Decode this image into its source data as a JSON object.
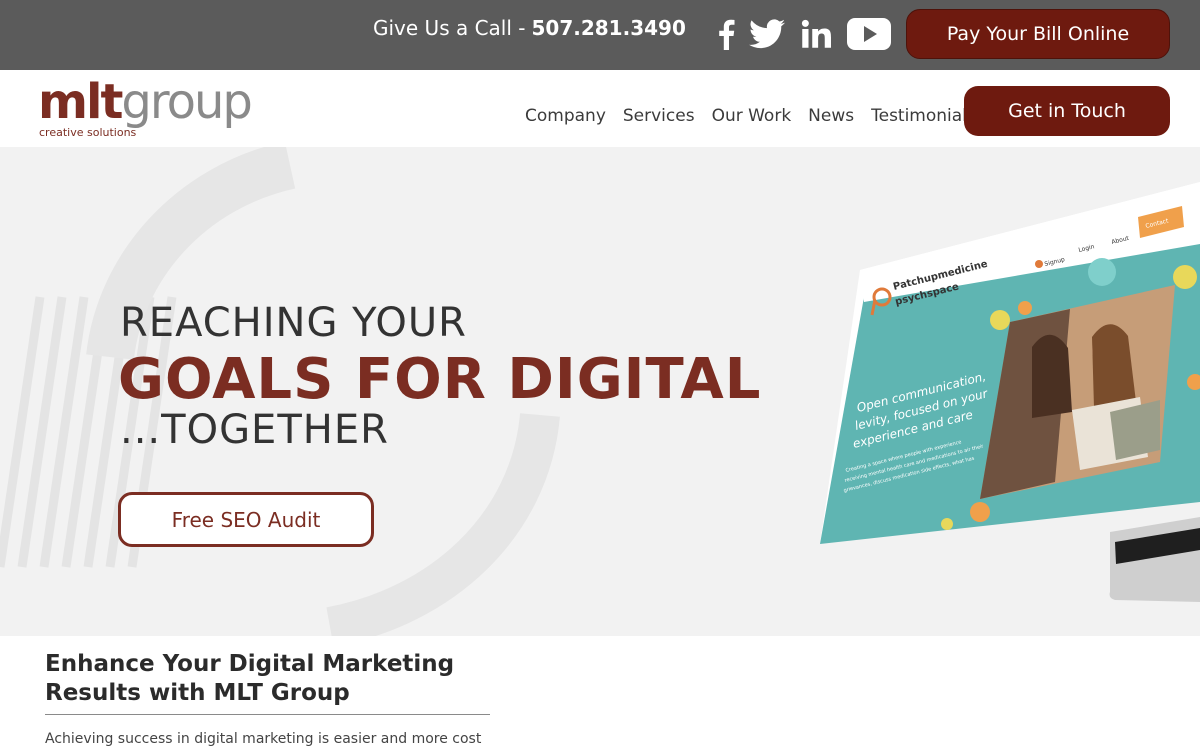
{
  "topbar": {
    "call_label": "Give Us a Call -",
    "phone": "507.281.3490",
    "social": [
      "facebook-icon",
      "twitter-icon",
      "linkedin-icon",
      "youtube-icon"
    ],
    "pay_button": "Pay Your Bill Online"
  },
  "header": {
    "logo_mlt": "mlt",
    "logo_group": "group",
    "logo_tagline": "creative solutions",
    "nav": [
      "Company",
      "Services",
      "Our Work",
      "News",
      "Testimonials"
    ],
    "cta_button": "Get in Touch"
  },
  "hero": {
    "line1": "REACHING YOUR",
    "line2": "GOALS FOR DIGITAL",
    "line3": "...TOGETHER",
    "button": "Free SEO Audit",
    "mockup": {
      "brand_line1": "Patchupmedicine",
      "brand_line2": "psychspace",
      "nav": [
        "Signup",
        "Login",
        "About",
        "Contact"
      ],
      "headline_lines": [
        "Open communication,",
        "levity, focused on your",
        "experience and care"
      ],
      "body_lines": [
        "Creating a space where people with experience",
        "receiving mental health care and medications to air their",
        "grievances, discuss medication side effects, what has"
      ]
    }
  },
  "content": {
    "title": "Enhance Your Digital Marketing Results with MLT Group",
    "text": "Achieving success in digital marketing is easier and more cost"
  },
  "colors": {
    "brand": "#7b2d22",
    "button": "#6e1a0f",
    "topbar": "#5b5b5b",
    "hero_bg": "#f2f2f2",
    "teal": "#5fb5b2"
  }
}
